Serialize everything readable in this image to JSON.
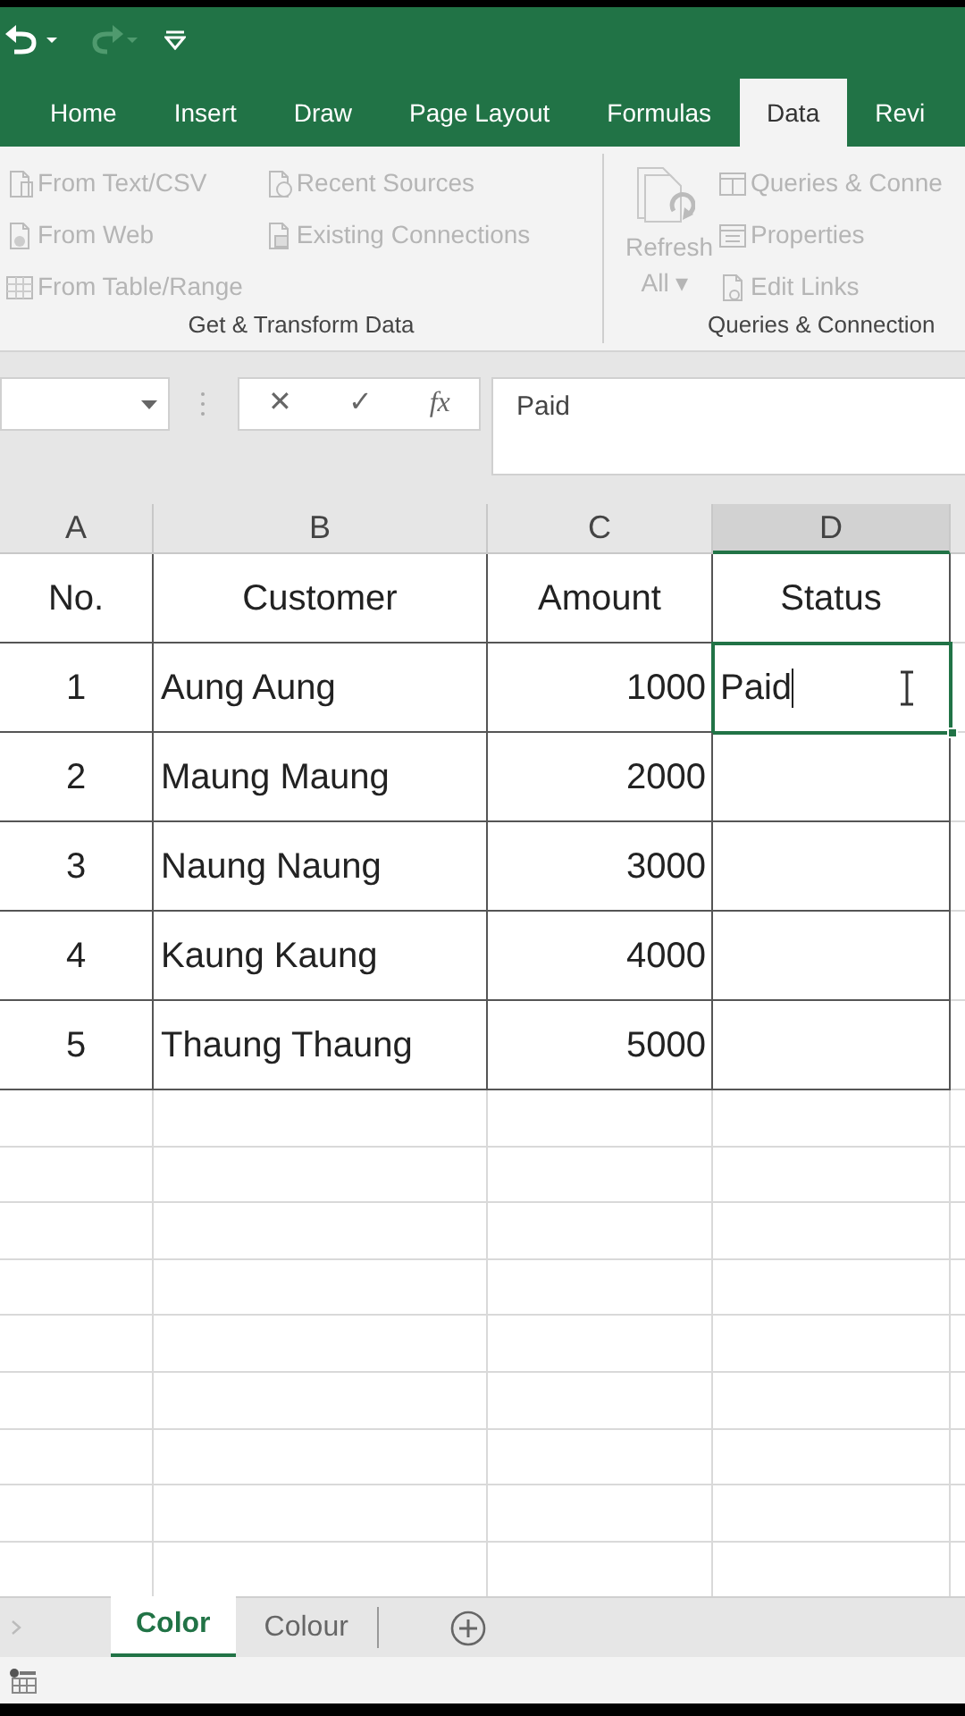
{
  "ribbon_tabs": [
    {
      "label": "Home",
      "selected": false
    },
    {
      "label": "Insert",
      "selected": false
    },
    {
      "label": "Draw",
      "selected": false
    },
    {
      "label": "Page Layout",
      "selected": false
    },
    {
      "label": "Formulas",
      "selected": false
    },
    {
      "label": "Data",
      "selected": true
    },
    {
      "label": "Revi",
      "selected": false
    }
  ],
  "ribbon_groups": [
    {
      "label": "Get & Transform Data",
      "commands": [
        {
          "kind": "small",
          "label": "From Text/CSV",
          "disabled": true
        },
        {
          "kind": "small",
          "label": "From Web",
          "disabled": true
        },
        {
          "kind": "small",
          "label": "From Table/Range",
          "disabled": true
        },
        {
          "kind": "small",
          "label": "Recent Sources",
          "disabled": true
        },
        {
          "kind": "small",
          "label": "Existing Connections",
          "disabled": true
        }
      ]
    },
    {
      "label": "Queries & Connection",
      "commands": [
        {
          "kind": "large",
          "label": "Refresh All ▾",
          "disabled": true
        },
        {
          "kind": "small",
          "label": "Queries & Conne",
          "disabled": true
        },
        {
          "kind": "small",
          "label": "Properties",
          "disabled": true
        },
        {
          "kind": "small",
          "label": "Edit Links",
          "disabled": true
        }
      ]
    }
  ],
  "formula_buttons": [
    "✕",
    "✓",
    "fx"
  ],
  "formula_bar": {
    "value": "Paid"
  },
  "columns": [
    {
      "label": "A",
      "selected": false
    },
    {
      "label": "B",
      "selected": false
    },
    {
      "label": "C",
      "selected": false
    },
    {
      "label": "D",
      "selected": true
    }
  ],
  "rows": [
    {
      "cells": [
        {
          "text": "No.",
          "selected": false
        },
        {
          "text": "Customer",
          "selected": false
        },
        {
          "text": "Amount",
          "selected": false
        },
        {
          "text": "Status",
          "selected": false
        }
      ]
    },
    {
      "cells": [
        {
          "text": "1",
          "selected": false
        },
        {
          "text": "Aung Aung",
          "selected": false
        },
        {
          "text": "1000",
          "selected": false
        },
        {
          "text": "Paid",
          "selected": true,
          "editing": true
        }
      ]
    },
    {
      "cells": [
        {
          "text": "2",
          "selected": false
        },
        {
          "text": "Maung Maung",
          "selected": false
        },
        {
          "text": "2000",
          "selected": false
        },
        {
          "selected": false
        }
      ]
    },
    {
      "cells": [
        {
          "text": "3",
          "selected": false
        },
        {
          "text": "Naung Naung",
          "selected": false
        },
        {
          "text": "3000",
          "selected": false
        },
        {
          "selected": false
        }
      ]
    },
    {
      "cells": [
        {
          "text": "4",
          "selected": false
        },
        {
          "text": "Kaung Kaung",
          "selected": false
        },
        {
          "text": "4000",
          "selected": false
        },
        {
          "selected": false
        }
      ]
    },
    {
      "cells": [
        {
          "text": "5",
          "selected": false
        },
        {
          "text": "Thaung Thaung",
          "selected": false
        },
        {
          "text": "5000",
          "selected": false
        },
        {
          "selected": false
        }
      ]
    }
  ],
  "sheet_tabs": [
    {
      "label": "Color",
      "selected": true
    },
    {
      "label": "Colour",
      "selected": false
    }
  ]
}
